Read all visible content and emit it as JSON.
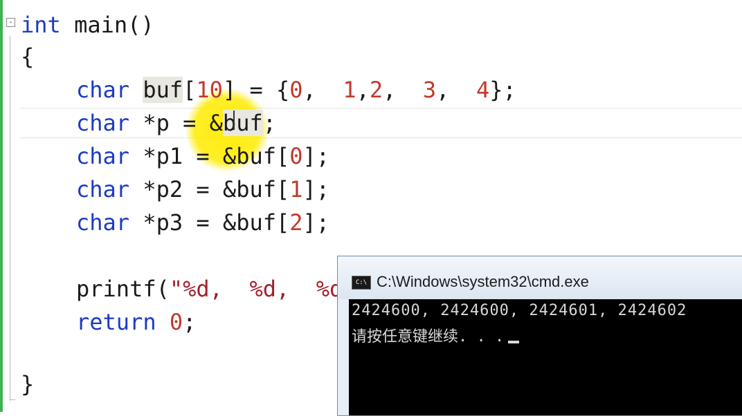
{
  "editor": {
    "lines": {
      "l1": {
        "kw": "int",
        "rest": " main()"
      },
      "l2": {
        "text": "{"
      },
      "l3": {
        "kw": "char",
        "sp": " ",
        "buf": "buf",
        "lb": "[",
        "n": "10",
        "rb": "]",
        "eq": " = {",
        "v0": "0",
        "c0": ",  ",
        "v1": "1",
        "c1": ",",
        "v2": "2",
        "c2": ",  ",
        "v3": "3",
        "c3": ",  ",
        "v4": "4",
        "end": "};"
      },
      "l4": {
        "kw": "char",
        "rest": " *p = &",
        "buf": "buf",
        "end": ";"
      },
      "l5": {
        "kw": "char",
        "rest": " *p1 = &buf",
        "lb": "[",
        "n": "0",
        "rb": "]",
        "end": ";"
      },
      "l6": {
        "kw": "char",
        "rest": " *p2 = &buf",
        "lb": "[",
        "n": "1",
        "rb": "]",
        "end": ";"
      },
      "l7": {
        "kw": "char",
        "rest": " *p3 = &buf",
        "lb": "[",
        "n": "2",
        "rb": "]",
        "end": ";"
      },
      "l8": {
        "fn": "printf(",
        "str": "\"%d,  %d,  %d,"
      },
      "l9": {
        "kw": "return",
        "sp": " ",
        "n": "0",
        "end": ";"
      },
      "l10": {
        "text": "}"
      }
    },
    "fold_symbol": "-"
  },
  "cmd": {
    "icon_text": "C:\\",
    "title": "C:\\Windows\\system32\\cmd.exe",
    "output_line1": "2424600, 2424600, 2424601, 2424602",
    "output_line2": "请按任意键继续. . ."
  }
}
